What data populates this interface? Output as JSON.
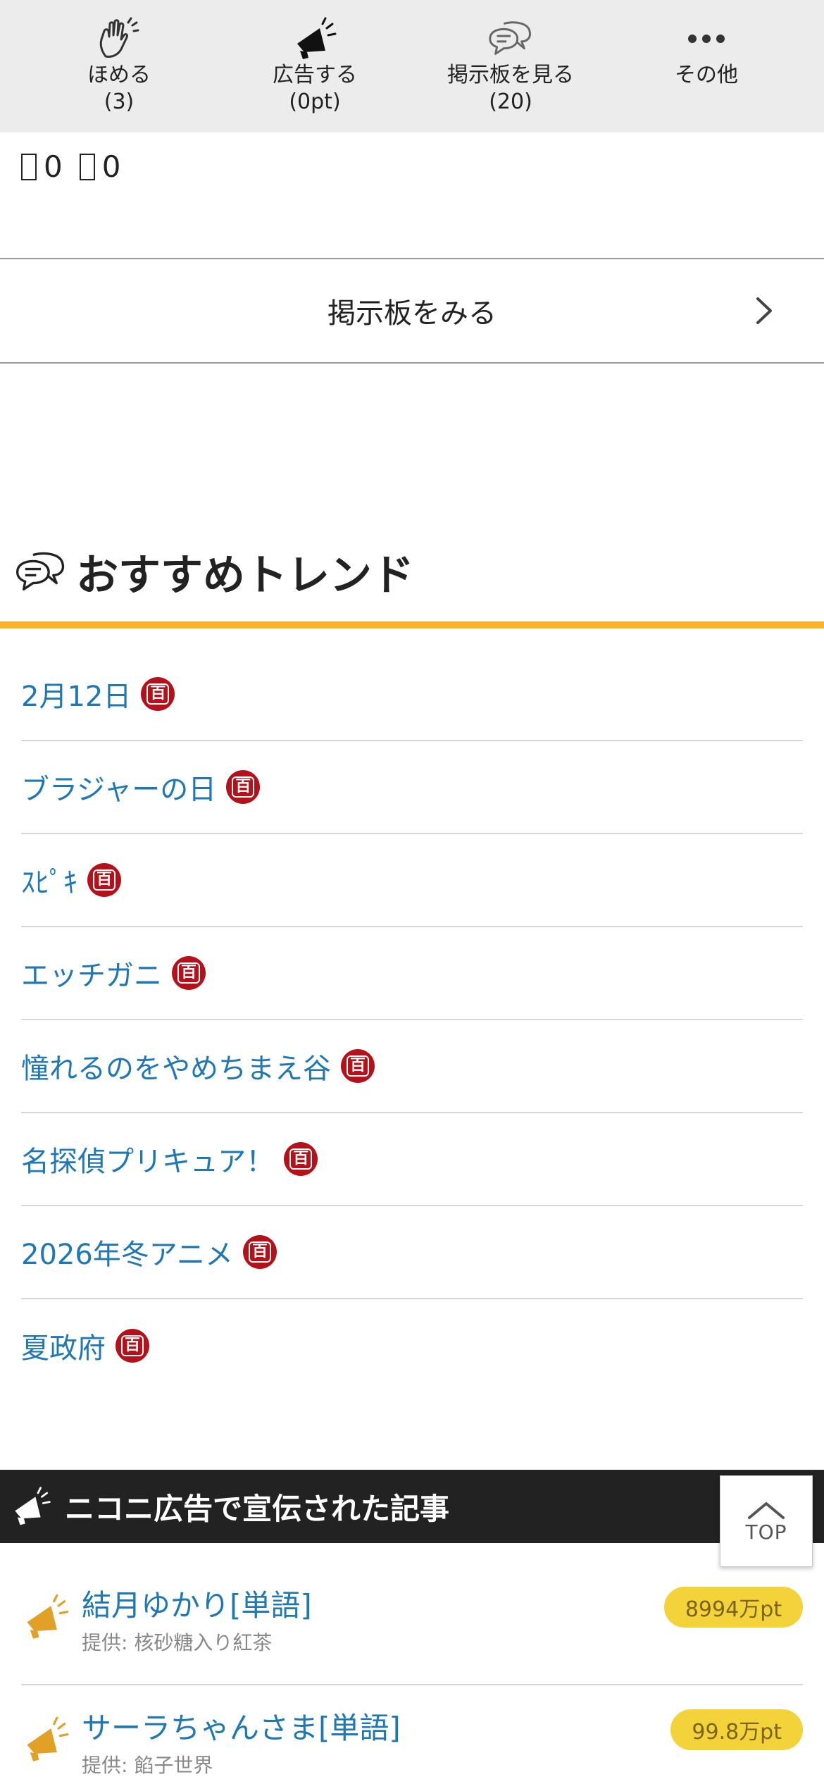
{
  "action_bar": [
    {
      "label": "ほめる",
      "count": "(3)",
      "icon": "clapping-hands-icon"
    },
    {
      "label": "広告する",
      "count": "(0pt)",
      "icon": "megaphone-icon"
    },
    {
      "label": "掲示板を見る",
      "count": "(20)",
      "icon": "chat-bubbles-icon"
    },
    {
      "label": "その他",
      "count": "",
      "icon": "more-dots-icon"
    }
  ],
  "counters": {
    "first": "0",
    "second": "0"
  },
  "board_link": {
    "label": "掲示板をみる"
  },
  "trend": {
    "title": "おすすめトレンド",
    "badge": "百",
    "items": [
      "2月12日",
      "ブラジャーの日",
      "ｽﾋﾟｷ",
      "エッチガニ",
      "憧れるのをやめちまえ谷",
      "名探偵プリキュア！",
      "2026年冬アニメ",
      "夏政府"
    ]
  },
  "ads": {
    "title": "ニコニ広告で宣伝された記事",
    "items": [
      {
        "title": "結月ゆかり[単語]",
        "sponsor": "提供: 核砂糖入り紅茶",
        "points": "8994万pt"
      },
      {
        "title": "サーラちゃんさま[単語]",
        "sponsor": "提供: 餡子世界",
        "points": "99.8万pt"
      }
    ]
  },
  "top_button": {
    "label": "TOP"
  },
  "colors": {
    "accent": "#f6b42a",
    "link": "#1f78b4",
    "badge": "#b4111a",
    "pill": "#f3d339",
    "dark_header": "#222222"
  }
}
